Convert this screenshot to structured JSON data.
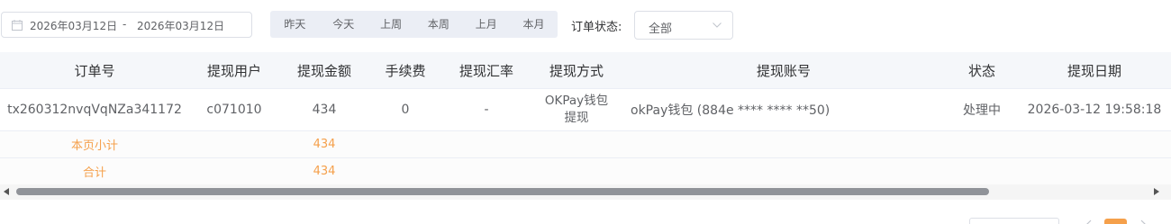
{
  "filters": {
    "date_start": "2026年03月12日",
    "date_separator": "-",
    "date_end": "2026年03月12日",
    "quick_ranges": [
      "昨天",
      "今天",
      "上周",
      "本周",
      "上月",
      "本月"
    ],
    "status_label": "订单状态:",
    "status_value": "全部"
  },
  "table": {
    "columns": [
      "订单号",
      "提现用户",
      "提现金额",
      "手续费",
      "提现汇率",
      "提现方式",
      "提现账号",
      "状态",
      "提现日期"
    ],
    "rows": [
      {
        "order_no": "tx260312nvqVqNZa341172",
        "user": "c071010",
        "amount": "434",
        "fee": "0",
        "rate": "-",
        "method_line1": "OKPay钱包",
        "method_line2": "提现",
        "account": "okPay钱包 (884e **** **** **50)",
        "status": "处理中",
        "date": "2026-03-12 19:58:18"
      }
    ],
    "page_subtotal_label": "本页小计",
    "page_subtotal_amount": "434",
    "total_label": "合计",
    "total_amount": "434"
  },
  "colors": {
    "accent": "#f5a04b",
    "header_bg": "#f5f7fa",
    "border": "#ebeef5"
  }
}
